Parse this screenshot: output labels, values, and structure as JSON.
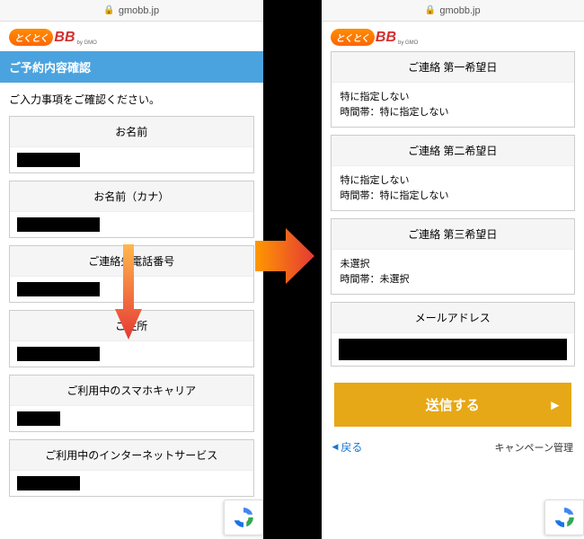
{
  "url": "gmobb.jp",
  "logo": {
    "badge": "とくとく",
    "bb": "BB",
    "sub": "by GMO"
  },
  "left": {
    "heading": "ご予約内容確認",
    "instruction": "ご入力事項をご確認ください。",
    "fields": {
      "name": "お名前",
      "name_kana": "お名前（カナ）",
      "phone": "ご連絡先電話番号",
      "address": "ご住所",
      "carrier": "ご利用中のスマホキャリア",
      "isp": "ご利用中のインターネットサービス"
    }
  },
  "right": {
    "contact1": {
      "label": "ご連絡 第一希望日",
      "value1": "特に指定しない",
      "value2": "時間帯：特に指定しない"
    },
    "contact2": {
      "label": "ご連絡 第二希望日",
      "value1": "特に指定しない",
      "value2": "時間帯：特に指定しない"
    },
    "contact3": {
      "label": "ご連絡 第三希望日",
      "value1": "未選択",
      "value2": "時間帯：未選択"
    },
    "email": {
      "label": "メールアドレス"
    },
    "submit": "送信する",
    "back": "戻る",
    "footer_link": "キャンペーン管理"
  }
}
